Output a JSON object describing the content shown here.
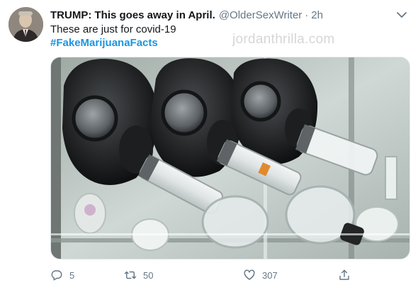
{
  "tweet": {
    "display_name": "TRUMP: This goes away in April.",
    "handle": "@OlderSexWriter",
    "separator": "·",
    "time": "2h",
    "text": "These are just for covid-19",
    "hashtag": "#FakeMarijuanaFacts",
    "watermark": "jordanthrilla.com"
  },
  "actions": {
    "replies": "5",
    "retweets": "50",
    "likes": "307"
  },
  "icons": {
    "reply": "reply-icon",
    "retweet": "retweet-icon",
    "like": "heart-icon",
    "share": "share-icon",
    "menu": "chevron-down-icon"
  },
  "colors": {
    "link": "#1b95e0",
    "secondary": "#657786",
    "text": "#14171a"
  }
}
